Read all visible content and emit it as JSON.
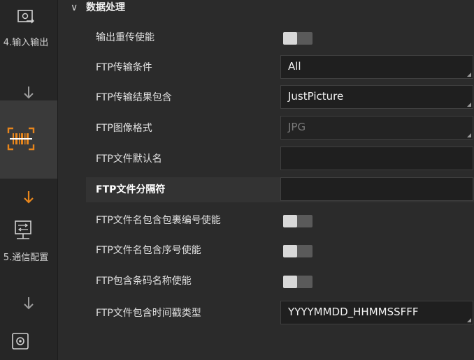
{
  "sidebar": {
    "steps": [
      {
        "label": "4.输入输出",
        "icon": "image-io-icon"
      },
      {
        "label": "",
        "icon": "barcode-scan-icon"
      },
      {
        "label": "5.通信配置",
        "icon": "network-config-icon"
      },
      {
        "label": "",
        "icon": "settings-icon"
      }
    ]
  },
  "section": {
    "title": "数据处理",
    "icon": "chevron-down-icon"
  },
  "rows": [
    {
      "label": "输出重传使能",
      "type": "toggle",
      "value": "off"
    },
    {
      "label": "FTP传输条件",
      "type": "select",
      "value": "All"
    },
    {
      "label": "FTP传输结果包含",
      "type": "select",
      "value": "JustPicture"
    },
    {
      "label": "FTP图像格式",
      "type": "select",
      "value": "JPG",
      "disabled": true
    },
    {
      "label": "FTP文件默认名",
      "type": "text",
      "value": ""
    },
    {
      "label": "FTP文件分隔符",
      "type": "text",
      "value": ""
    },
    {
      "label": "FTP文件名包含包裹编号使能",
      "type": "toggle",
      "value": "off"
    },
    {
      "label": "FTP文件名包含序号使能",
      "type": "toggle",
      "value": "off"
    },
    {
      "label": "FTP包含条码名称使能",
      "type": "toggle",
      "value": "off"
    },
    {
      "label": "FTP文件包含时间戳类型",
      "type": "select",
      "value": "YYYYMMDD_HHMMSSFFF"
    }
  ],
  "colors": {
    "accent": "#e8861c",
    "active_bg": "#3a3a3a"
  }
}
